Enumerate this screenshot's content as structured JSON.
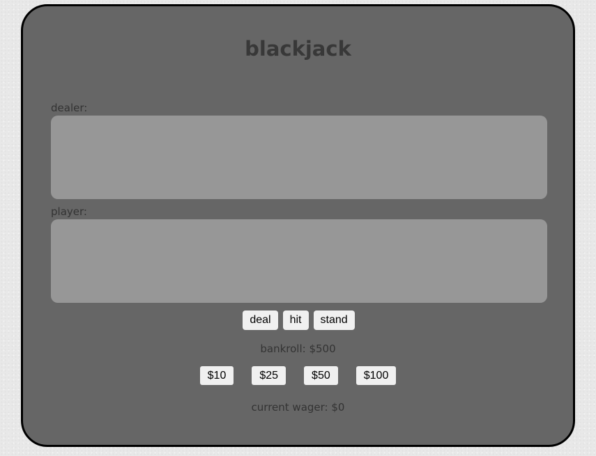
{
  "title": "blackjack",
  "dealer": {
    "label": "dealer:"
  },
  "player": {
    "label": "player:"
  },
  "actions": {
    "deal": "deal",
    "hit": "hit",
    "stand": "stand"
  },
  "bankroll": "bankroll: $500",
  "wagers": [
    "$10",
    "$25",
    "$50",
    "$100"
  ],
  "current_wager": "current wager: $0",
  "colors": {
    "table": "#666666",
    "border": "#000000",
    "hand_area": "#979797",
    "button": "#f0f0f0",
    "text": "#333333"
  }
}
